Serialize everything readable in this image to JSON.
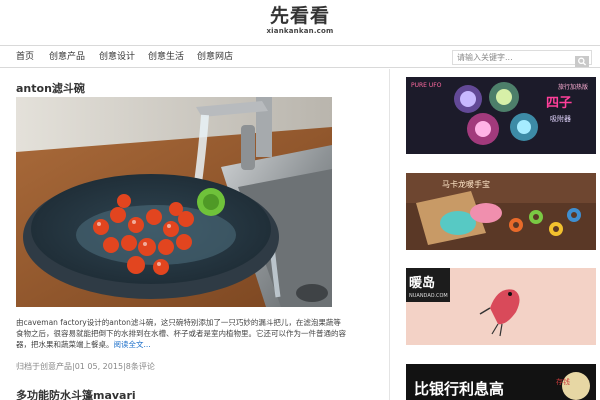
{
  "header": {
    "logo_cn": "先看看",
    "logo_domain": "xiankankan.com"
  },
  "nav": {
    "items": [
      {
        "label": "首页"
      },
      {
        "label": "创意产品"
      },
      {
        "label": "创意设计"
      },
      {
        "label": "创意生活"
      },
      {
        "label": "创意网店"
      }
    ],
    "search_placeholder": "请输入关键字..."
  },
  "post": {
    "title": "anton滤斗碗",
    "excerpt": "由caveman factory设计的anton滤斗碗，这只碗特别添加了一只巧妙的漏斗把儿，在滤泡果蔬等食物之后，很容易就能把倒下的水排到在水槽、杯子或者是室内植物里。它还可以作为一件普通的容器，把水果和蔬菜端上餐桌。",
    "read_more": "阅读全文...",
    "meta": "归档于创意产品|01 05, 2015|8条评论"
  },
  "next_post": {
    "title": "多功能防水斗篷mavari"
  },
  "sidebar": {
    "ads": [
      {
        "texts": [
          "PURE UFO",
          "旅行加热版",
          "四子",
          "吸附器"
        ]
      },
      {
        "texts": [
          "马卡龙暖手宝"
        ]
      },
      {
        "texts": [
          "暖岛",
          "NUANDAO.COM"
        ]
      },
      {
        "texts": [
          "比银行利息高",
          "存钱"
        ]
      }
    ]
  },
  "colors": {
    "accent_link": "#1a6ec9",
    "nav_border": "#d9d9d9",
    "text": "#333333"
  }
}
